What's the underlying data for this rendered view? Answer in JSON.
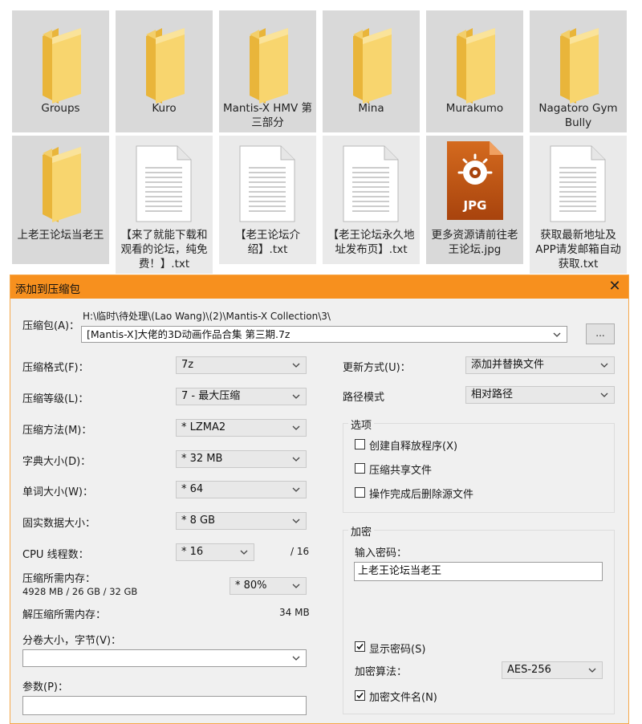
{
  "files": [
    {
      "label": "Groups",
      "icon": "folder-icon"
    },
    {
      "label": "Kuro",
      "icon": "folder-icon"
    },
    {
      "label": "Mantis-X HMV 第三部分",
      "icon": "folder-icon"
    },
    {
      "label": "Mina",
      "icon": "folder-icon"
    },
    {
      "label": "Murakumo",
      "icon": "folder-icon"
    },
    {
      "label": "Nagatoro Gym Bully",
      "icon": "folder-icon"
    },
    {
      "label": "上老王论坛当老王",
      "icon": "folder-icon"
    },
    {
      "label": "【来了就能下载和观看的论坛，纯免费！】.txt",
      "icon": "text-file-icon"
    },
    {
      "label": "【老王论坛介绍】.txt",
      "icon": "text-file-icon"
    },
    {
      "label": "【老王论坛永久地址发布页】.txt",
      "icon": "text-file-icon"
    },
    {
      "label": "更多资源请前往老王论坛.jpg",
      "icon": "jpg-file-icon",
      "badge": "JPG"
    },
    {
      "label": "获取最新地址及APP请发邮箱自动获取.txt",
      "icon": "text-file-icon"
    }
  ],
  "dialog": {
    "title": "添加到压缩包",
    "archive_label": "压缩包(A)：",
    "archive_path": "H:\\临时\\待处理\\(Lao Wang)\\(2)\\Mantis-X Collection\\3\\",
    "archive_name": "[Mantis-X]大佬的3D动画作品合集 第三期.7z",
    "browse_label": "...",
    "format_label": "压缩格式(F)：",
    "format_value": "7z",
    "level_label": "压缩等级(L)：",
    "level_value": "7 - 最大压缩",
    "method_label": "压缩方法(M)：",
    "method_value": "* LZMA2",
    "dict_label": "字典大小(D)：",
    "dict_value": "* 32 MB",
    "word_label": "单词大小(W)：",
    "word_value": "* 64",
    "solid_label": "固实数据大小：",
    "solid_value": "* 8 GB",
    "cpu_label": "CPU 线程数：",
    "cpu_value": "* 16",
    "cpu_total": "/ 16",
    "mem_label": "压缩所需内存：",
    "mem_value": "4928 MB / 26 GB / 32 GB",
    "mem_percent": "* 80%",
    "decomp_label": "解压缩所需内存：",
    "decomp_value": "34 MB",
    "volume_label": "分卷大小，字节(V)：",
    "volume_value": "",
    "params_label": "参数(P)：",
    "params_value": "",
    "update_label": "更新方式(U)：",
    "update_value": "添加并替换文件",
    "path_label": "路径模式",
    "path_value": "相对路径",
    "options_title": "选项",
    "opt_sfx": "创建自释放程序(X)",
    "opt_shared": "压缩共享文件",
    "opt_delete": "操作完成后删除源文件",
    "enc_title": "加密",
    "enc_password_label": "输入密码：",
    "enc_password_value": "上老王论坛当老王",
    "show_password": "显示密码(S)",
    "enc_method_label": "加密算法：",
    "enc_method_value": "AES-256",
    "enc_names": "加密文件名(N)"
  },
  "colors": {
    "titlebar": "#f7901e",
    "folder": "#f5c842",
    "tile_bg": "#d9d9d9",
    "jpg": "#e35b0c"
  }
}
